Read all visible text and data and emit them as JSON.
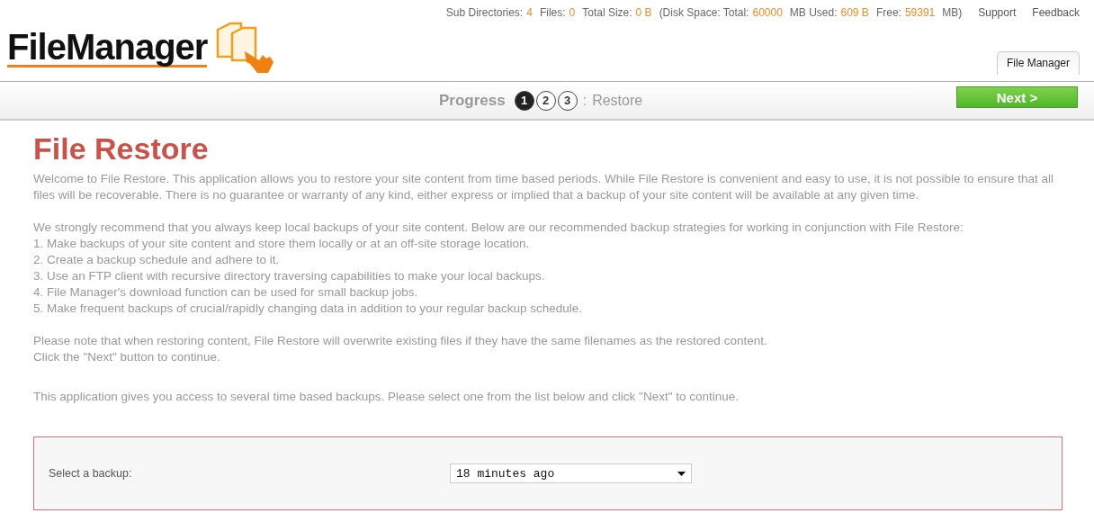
{
  "stats": [
    {
      "label": "Sub Directories:",
      "value": "4"
    },
    {
      "label": "Files:",
      "value": "0"
    },
    {
      "label": "Total Size:",
      "value": "0 B"
    },
    {
      "label": "(Disk Space: Total:",
      "value": "60000"
    },
    {
      "label": "MB Used:",
      "value": "609 B"
    },
    {
      "label": "Free:",
      "value": "59391"
    }
  ],
  "stats_suffix": "MB)",
  "top_links": [
    "Support",
    "Feedback"
  ],
  "logo": "FileManager",
  "tabs": [
    {
      "label": "File Manager",
      "selected": true
    }
  ],
  "progress": {
    "label": "Progress",
    "steps": [
      {
        "label": "1",
        "selected": true
      },
      {
        "label": "2",
        "selected": false
      },
      {
        "label": "3",
        "selected": false
      }
    ],
    "separator": ":",
    "step_name": "Restore"
  },
  "next_button": "Next >",
  "title": "File Restore",
  "paragraphs": [
    [
      "Welcome to File Restore. This application allows you to restore your site content from time based periods. While File Restore is convenient and easy to use, it is not possible to ensure that all files will be recoverable. There is no guarantee or warranty of any kind, either express or implied that a backup of your site content will be available at any given time."
    ],
    [
      "We strongly recommend that you always keep local backups of your site content. Below are our recommended backup strategies for working in conjunction with File Restore:",
      "1. Make backups of your site content and store them locally or at an off-site storage location.",
      "2. Create a backup schedule and adhere to it.",
      "3. Use an FTP client with recursive directory traversing capabilities to make your local backups.",
      "4. File Manager's download function can be used for small backup jobs.",
      "5. Make frequent backups of crucial/rapidly changing data in addition to your regular backup schedule."
    ],
    [
      "Please note that when restoring content, File Restore will overwrite existing files if they have the same filenames as the restored content.",
      "Click the \"Next\" button to continue."
    ]
  ],
  "instruction": "This application gives you access to several time based backups. Please select one from the list below and click \"Next\" to continue.",
  "backup": {
    "label": "Select a backup:",
    "value": "18 minutes ago"
  }
}
